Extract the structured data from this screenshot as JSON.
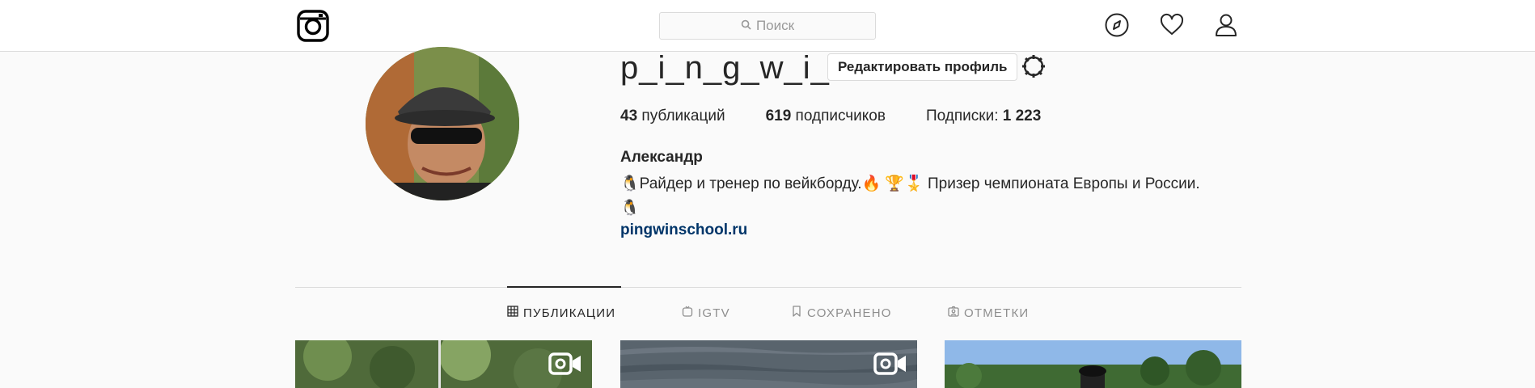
{
  "header": {
    "logo_icon": "instagram-logo-icon",
    "search_placeholder": "Поиск",
    "nav_icons": [
      "compass-icon",
      "heart-icon",
      "user-icon"
    ]
  },
  "profile": {
    "username": "p_i_n_g_w_i_n",
    "edit_button": "Редактировать профиль",
    "settings_icon": "gear-icon",
    "stats": {
      "posts_count": "43",
      "posts_label": "публикаций",
      "followers_count": "619",
      "followers_label": "подписчиков",
      "following_label": "Подписки:",
      "following_count": "1 223"
    },
    "full_name": "Александр",
    "bio_line1": "🐧Райдер и тренер по вейкборду.🔥 🏆🎖️ Призер чемпионата Европы и России.",
    "bio_line2": "🐧",
    "website": "pingwinschool.ru"
  },
  "tabs": [
    {
      "label": "ПУБЛИКАЦИИ",
      "icon": "grid-icon",
      "active": true
    },
    {
      "label": "IGTV",
      "icon": "igtv-icon",
      "active": false
    },
    {
      "label": "СОХРАНЕНО",
      "icon": "bookmark-icon",
      "active": false
    },
    {
      "label": "ОТМЕТКИ",
      "icon": "tagged-icon",
      "active": false
    }
  ],
  "posts": [
    {
      "type": "video",
      "icon": "video-camera-icon"
    },
    {
      "type": "video",
      "icon": "video-camera-icon"
    },
    {
      "type": "image"
    }
  ]
}
